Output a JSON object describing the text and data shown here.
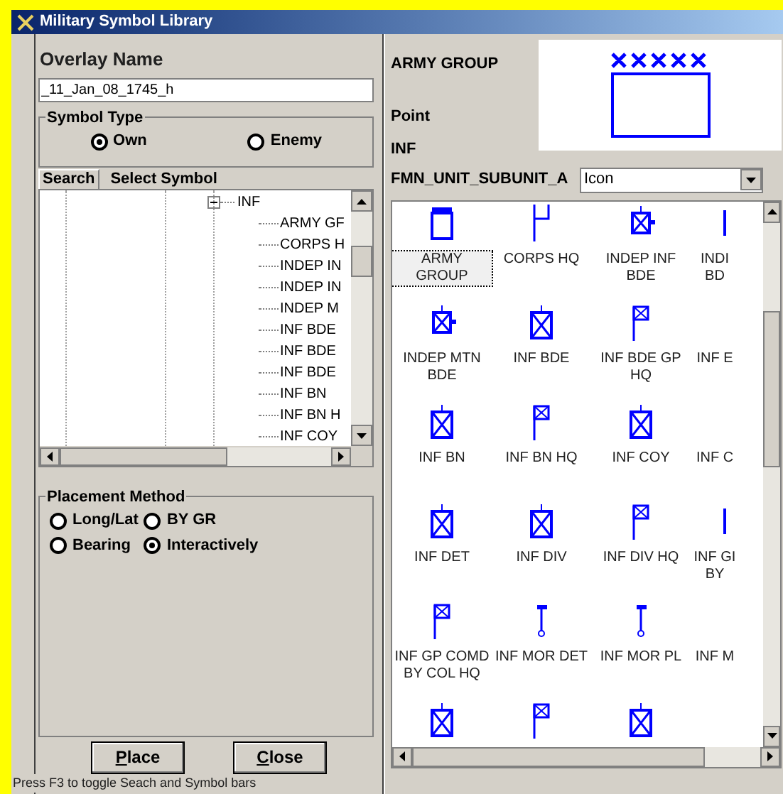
{
  "window": {
    "title": "Military Symbol Library"
  },
  "overlay": {
    "label": "Overlay Name",
    "value": "_11_Jan_08_1745_h"
  },
  "symbol_type": {
    "label": "Symbol Type",
    "options": [
      {
        "label": "Own",
        "selected": true
      },
      {
        "label": "Enemy",
        "selected": false
      }
    ]
  },
  "tabs": [
    {
      "label": "Search",
      "selected": true
    },
    {
      "label": "Select Symbol",
      "selected": false
    }
  ],
  "tree": [
    {
      "label": "INF",
      "expanded": true,
      "children": [
        {
          "label": "ARMY GF"
        },
        {
          "label": "CORPS H"
        },
        {
          "label": "INDEP IN"
        },
        {
          "label": "INDEP IN"
        },
        {
          "label": "INDEP M"
        },
        {
          "label": "INF BDE"
        },
        {
          "label": "INF BDE"
        },
        {
          "label": "INF BDE"
        },
        {
          "label": "INF BN"
        },
        {
          "label": "INF BN H"
        },
        {
          "label": "INF COY"
        }
      ]
    }
  ],
  "placement": {
    "label": "Placement Method",
    "options": [
      {
        "label": "Long/Lat",
        "selected": false
      },
      {
        "label": "BY GR",
        "selected": false
      },
      {
        "label": "Bearing",
        "selected": false
      },
      {
        "label": "Interactively",
        "selected": true
      }
    ]
  },
  "buttons": [
    {
      "label": "Place"
    },
    {
      "label": "Close"
    }
  ],
  "status_bar": "Press F3 to toggle Seach and Symbol  bars",
  "details": {
    "name": "ARMY GROUP",
    "type": "Point",
    "category": "INF",
    "field_label": "FMN_UNIT_SUBUNIT_A",
    "view": "Icon"
  },
  "symbols": [
    {
      "label": "ARMY GROUP",
      "kind": "group",
      "selected": true
    },
    {
      "label": "CORPS HQ",
      "kind": "flag-plain",
      "selected": false
    },
    {
      "label": "INDEP INF BDE",
      "kind": "indep",
      "selected": false
    },
    {
      "label": "INDI BD",
      "kind": "hq-bar",
      "selected": false
    },
    {
      "label": "INDEP MTN BDE",
      "kind": "indep",
      "selected": false
    },
    {
      "label": "INF BDE",
      "kind": "unit",
      "selected": false
    },
    {
      "label": "INF BDE GP HQ",
      "kind": "flag",
      "selected": false
    },
    {
      "label": "INF E",
      "kind": "none",
      "selected": false
    },
    {
      "label": "INF BN",
      "kind": "unit",
      "selected": false
    },
    {
      "label": "INF BN HQ",
      "kind": "flag",
      "selected": false
    },
    {
      "label": "INF COY",
      "kind": "unit",
      "selected": false
    },
    {
      "label": "INF C",
      "kind": "none",
      "selected": false
    },
    {
      "label": "INF DET",
      "kind": "unit",
      "selected": false
    },
    {
      "label": "INF DIV",
      "kind": "unit",
      "selected": false
    },
    {
      "label": "INF DIV HQ",
      "kind": "flag",
      "selected": false
    },
    {
      "label": "INF GI BY",
      "kind": "hq-bar",
      "selected": false
    },
    {
      "label": "INF GP COMD BY COL HQ",
      "kind": "flag",
      "selected": false
    },
    {
      "label": "INF MOR DET",
      "kind": "mortar",
      "selected": false
    },
    {
      "label": "INF MOR PL",
      "kind": "mortar",
      "selected": false
    },
    {
      "label": "INF M",
      "kind": "none",
      "selected": false
    },
    {
      "kind": "unit",
      "selected": false
    },
    {
      "kind": "flag",
      "selected": false
    },
    {
      "kind": "unit",
      "selected": false
    }
  ]
}
